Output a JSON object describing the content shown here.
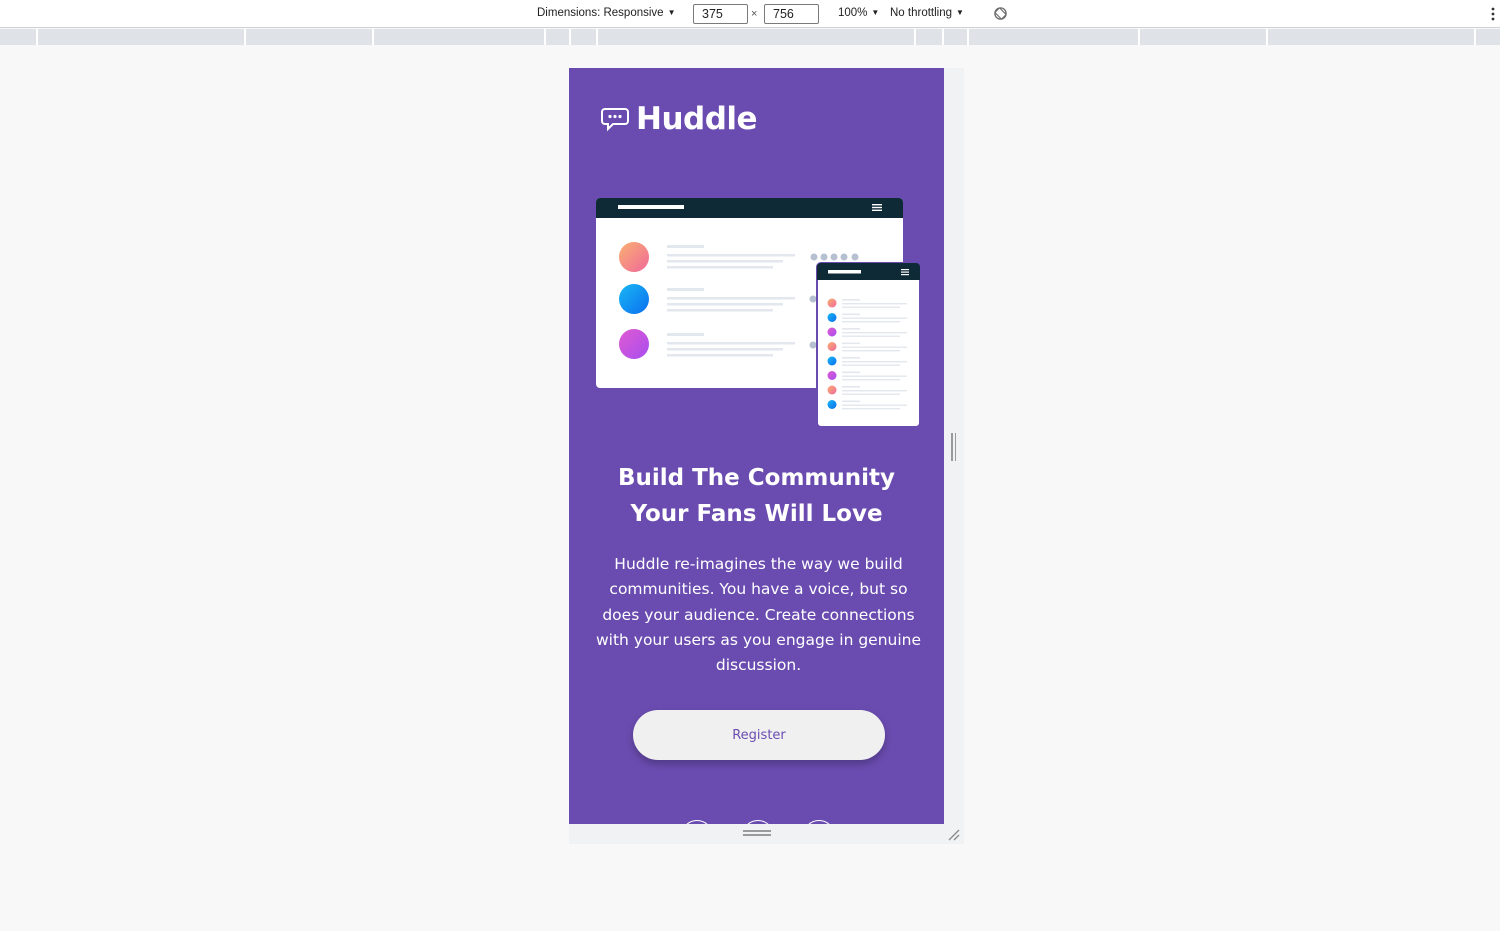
{
  "devtools": {
    "dimensions_label": "Dimensions: Responsive",
    "width_value": "375",
    "times": "×",
    "height_value": "756",
    "zoom": "100%",
    "throttling": "No throttling",
    "caret": "▼"
  },
  "page": {
    "logo_text": "Huddle",
    "headline_line1": "Build The Community",
    "headline_line2": "Your Fans Will Love",
    "description": "Huddle re-imagines the way we build communities. You have a voice, but so does your audience. Create connections with your users as you engage in genuine discussion.",
    "register_label": "Register"
  },
  "colors": {
    "brand_purple": "#6a4cb0",
    "button_bg": "#f0f0f1",
    "mockup_header": "#0f2a37",
    "avatar_orange": "#f68c79",
    "avatar_blue": "#0a9af0",
    "avatar_magenta": "#c84fe0"
  },
  "icons": [
    "chat-bubble-icon",
    "rotate-icon",
    "more-vert-icon",
    "hamburger-icon"
  ]
}
